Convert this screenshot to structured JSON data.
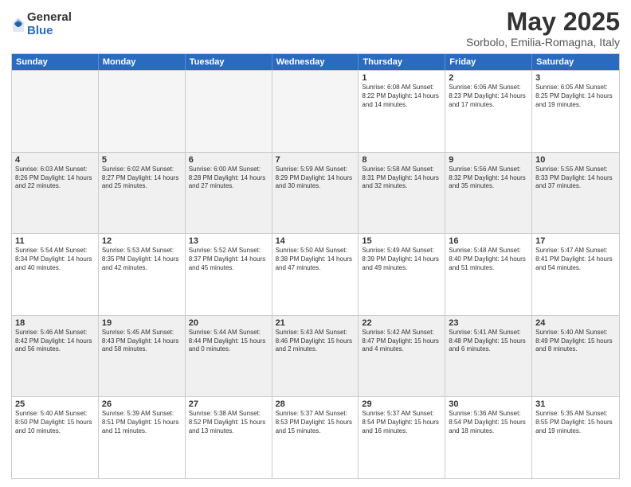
{
  "logo": {
    "general": "General",
    "blue": "Blue"
  },
  "title": {
    "month": "May 2025",
    "location": "Sorbolo, Emilia-Romagna, Italy"
  },
  "weekdays": [
    "Sunday",
    "Monday",
    "Tuesday",
    "Wednesday",
    "Thursday",
    "Friday",
    "Saturday"
  ],
  "rows": [
    [
      {
        "day": "",
        "text": "",
        "empty": true
      },
      {
        "day": "",
        "text": "",
        "empty": true
      },
      {
        "day": "",
        "text": "",
        "empty": true
      },
      {
        "day": "",
        "text": "",
        "empty": true
      },
      {
        "day": "1",
        "text": "Sunrise: 6:08 AM\nSunset: 8:22 PM\nDaylight: 14 hours and 14 minutes.",
        "empty": false
      },
      {
        "day": "2",
        "text": "Sunrise: 6:06 AM\nSunset: 8:23 PM\nDaylight: 14 hours and 17 minutes.",
        "empty": false
      },
      {
        "day": "3",
        "text": "Sunrise: 6:05 AM\nSunset: 8:25 PM\nDaylight: 14 hours and 19 minutes.",
        "empty": false
      }
    ],
    [
      {
        "day": "4",
        "text": "Sunrise: 6:03 AM\nSunset: 8:26 PM\nDaylight: 14 hours and 22 minutes.",
        "empty": false
      },
      {
        "day": "5",
        "text": "Sunrise: 6:02 AM\nSunset: 8:27 PM\nDaylight: 14 hours and 25 minutes.",
        "empty": false
      },
      {
        "day": "6",
        "text": "Sunrise: 6:00 AM\nSunset: 8:28 PM\nDaylight: 14 hours and 27 minutes.",
        "empty": false
      },
      {
        "day": "7",
        "text": "Sunrise: 5:59 AM\nSunset: 8:29 PM\nDaylight: 14 hours and 30 minutes.",
        "empty": false
      },
      {
        "day": "8",
        "text": "Sunrise: 5:58 AM\nSunset: 8:31 PM\nDaylight: 14 hours and 32 minutes.",
        "empty": false
      },
      {
        "day": "9",
        "text": "Sunrise: 5:56 AM\nSunset: 8:32 PM\nDaylight: 14 hours and 35 minutes.",
        "empty": false
      },
      {
        "day": "10",
        "text": "Sunrise: 5:55 AM\nSunset: 8:33 PM\nDaylight: 14 hours and 37 minutes.",
        "empty": false
      }
    ],
    [
      {
        "day": "11",
        "text": "Sunrise: 5:54 AM\nSunset: 8:34 PM\nDaylight: 14 hours and 40 minutes.",
        "empty": false
      },
      {
        "day": "12",
        "text": "Sunrise: 5:53 AM\nSunset: 8:35 PM\nDaylight: 14 hours and 42 minutes.",
        "empty": false
      },
      {
        "day": "13",
        "text": "Sunrise: 5:52 AM\nSunset: 8:37 PM\nDaylight: 14 hours and 45 minutes.",
        "empty": false
      },
      {
        "day": "14",
        "text": "Sunrise: 5:50 AM\nSunset: 8:38 PM\nDaylight: 14 hours and 47 minutes.",
        "empty": false
      },
      {
        "day": "15",
        "text": "Sunrise: 5:49 AM\nSunset: 8:39 PM\nDaylight: 14 hours and 49 minutes.",
        "empty": false
      },
      {
        "day": "16",
        "text": "Sunrise: 5:48 AM\nSunset: 8:40 PM\nDaylight: 14 hours and 51 minutes.",
        "empty": false
      },
      {
        "day": "17",
        "text": "Sunrise: 5:47 AM\nSunset: 8:41 PM\nDaylight: 14 hours and 54 minutes.",
        "empty": false
      }
    ],
    [
      {
        "day": "18",
        "text": "Sunrise: 5:46 AM\nSunset: 8:42 PM\nDaylight: 14 hours and 56 minutes.",
        "empty": false
      },
      {
        "day": "19",
        "text": "Sunrise: 5:45 AM\nSunset: 8:43 PM\nDaylight: 14 hours and 58 minutes.",
        "empty": false
      },
      {
        "day": "20",
        "text": "Sunrise: 5:44 AM\nSunset: 8:44 PM\nDaylight: 15 hours and 0 minutes.",
        "empty": false
      },
      {
        "day": "21",
        "text": "Sunrise: 5:43 AM\nSunset: 8:46 PM\nDaylight: 15 hours and 2 minutes.",
        "empty": false
      },
      {
        "day": "22",
        "text": "Sunrise: 5:42 AM\nSunset: 8:47 PM\nDaylight: 15 hours and 4 minutes.",
        "empty": false
      },
      {
        "day": "23",
        "text": "Sunrise: 5:41 AM\nSunset: 8:48 PM\nDaylight: 15 hours and 6 minutes.",
        "empty": false
      },
      {
        "day": "24",
        "text": "Sunrise: 5:40 AM\nSunset: 8:49 PM\nDaylight: 15 hours and 8 minutes.",
        "empty": false
      }
    ],
    [
      {
        "day": "25",
        "text": "Sunrise: 5:40 AM\nSunset: 8:50 PM\nDaylight: 15 hours and 10 minutes.",
        "empty": false
      },
      {
        "day": "26",
        "text": "Sunrise: 5:39 AM\nSunset: 8:51 PM\nDaylight: 15 hours and 11 minutes.",
        "empty": false
      },
      {
        "day": "27",
        "text": "Sunrise: 5:38 AM\nSunset: 8:52 PM\nDaylight: 15 hours and 13 minutes.",
        "empty": false
      },
      {
        "day": "28",
        "text": "Sunrise: 5:37 AM\nSunset: 8:53 PM\nDaylight: 15 hours and 15 minutes.",
        "empty": false
      },
      {
        "day": "29",
        "text": "Sunrise: 5:37 AM\nSunset: 8:54 PM\nDaylight: 15 hours and 16 minutes.",
        "empty": false
      },
      {
        "day": "30",
        "text": "Sunrise: 5:36 AM\nSunset: 8:54 PM\nDaylight: 15 hours and 18 minutes.",
        "empty": false
      },
      {
        "day": "31",
        "text": "Sunrise: 5:35 AM\nSunset: 8:55 PM\nDaylight: 15 hours and 19 minutes.",
        "empty": false
      }
    ]
  ]
}
